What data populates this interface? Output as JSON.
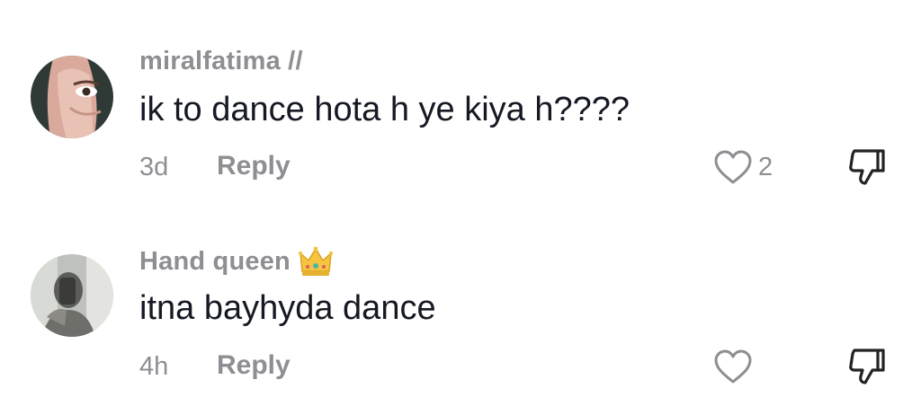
{
  "comments": [
    {
      "username": "miralfatima //",
      "text": "ik to dance hota h ye kiya h????",
      "time": "3d",
      "reply_label": "Reply",
      "like_count": "2",
      "like_icon": "heart-outline-icon",
      "dislike_icon": "thumbs-down-icon"
    },
    {
      "username": "Hand queen",
      "badge_icon": "crown-icon",
      "text": "itna bayhyda dance",
      "time": "4h",
      "reply_label": "Reply",
      "like_count": "",
      "like_icon": "heart-outline-icon",
      "dislike_icon": "thumbs-down-icon"
    }
  ],
  "colors": {
    "muted": "#8e8e93",
    "text": "#161823",
    "background": "#ffffff",
    "crown": "#f5c542"
  }
}
